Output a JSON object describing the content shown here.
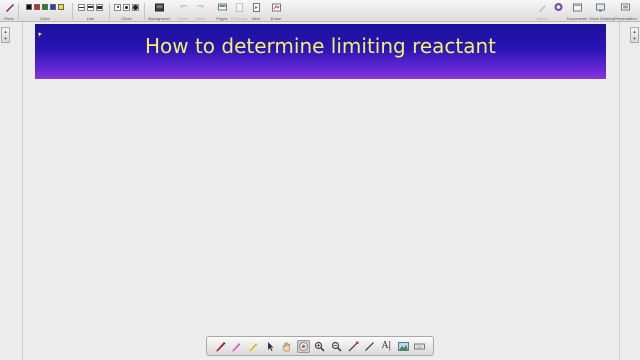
{
  "toolbar": {
    "groups": {
      "pens": "Pens",
      "color": "Color",
      "line": "Line",
      "circle": "Circle",
      "background": "Background",
      "undo": "Undo",
      "redo": "Redo",
      "pages": "Pages",
      "previous": "Previous",
      "next": "Next",
      "erase": "Erase",
      "about": "About",
      "documents": "Documents",
      "show_desktop": "Show Desktop",
      "presentation": "Presentation"
    },
    "pen_colors": [
      "#111111",
      "#e02020",
      "#1a8a1a",
      "#1a3fd0",
      "#f0e020"
    ]
  },
  "banner": {
    "title": "How to determine limiting reactant",
    "title_color": "#f2f26a",
    "gradient_top": "#1a1199",
    "gradient_bottom": "#8a38d8"
  },
  "floating_toolbar": {
    "text_tool_label": "A|",
    "active_tool": "capture"
  }
}
